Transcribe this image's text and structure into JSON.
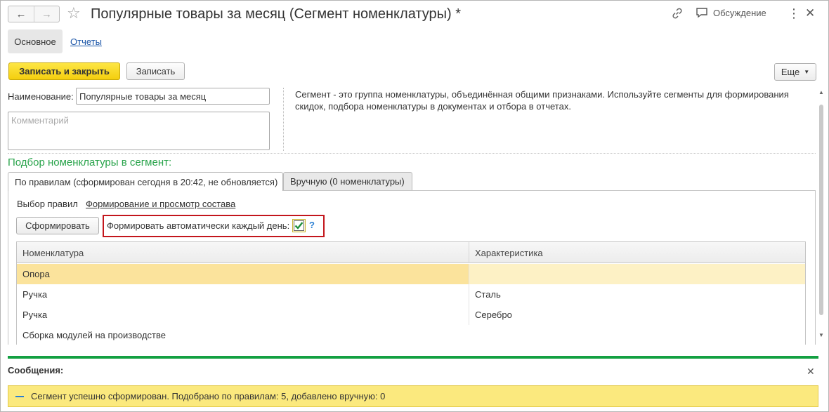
{
  "window": {
    "title": "Популярные товары за месяц (Сегмент номенклатуры) *",
    "discuss_label": "Обсуждение"
  },
  "section_tabs": [
    {
      "label": "Основное",
      "active": true
    },
    {
      "label": "Отчеты",
      "active": false
    }
  ],
  "toolbar": {
    "save_close_label": "Записать и закрыть",
    "save_label": "Записать",
    "more_label": "Еще"
  },
  "form": {
    "name_label": "Наименование:",
    "name_value": "Популярные товары за месяц",
    "comment_placeholder": "Комментарий",
    "hint": "Сегмент - это группа номенклатуры, объединённая общими признаками. Используйте сегменты для формирования скидок, подбора номенклатуры  в документах и отбора в отчетах."
  },
  "selection": {
    "group_title": "Подбор номенклатуры в сегмент:",
    "tabs": [
      {
        "label": "По правилам (сформирован сегодня в 20:42, не обновляется)",
        "active": true
      },
      {
        "label": "Вручную (0 номенклатуры)",
        "active": false
      }
    ],
    "rules_label": "Выбор правил",
    "rules_link": "Формирование и просмотр состава",
    "form_button": "Сформировать",
    "auto_label": "Формировать автоматически каждый день:",
    "auto_checked": true,
    "help": "?"
  },
  "table": {
    "columns": [
      "Номенклатура",
      "Характеристика"
    ],
    "rows": [
      {
        "item": "Опора",
        "characteristic": "",
        "selected": true
      },
      {
        "item": "Ручка",
        "characteristic": "Сталь",
        "selected": false
      },
      {
        "item": "Ручка",
        "characteristic": "Серебро",
        "selected": false
      },
      {
        "item": "Сборка модулей на производстве",
        "characteristic": "",
        "selected": false
      }
    ]
  },
  "messages": {
    "title": "Сообщения:",
    "text": "Сегмент успешно сформирован. Подобрано по правилам: 5, добавлено вручную: 0"
  },
  "colors": {
    "accent_green": "#13a042",
    "primary_yellow": "#f4cf0e",
    "highlight_red": "#c3161c",
    "link_blue": "#1a55a8"
  }
}
